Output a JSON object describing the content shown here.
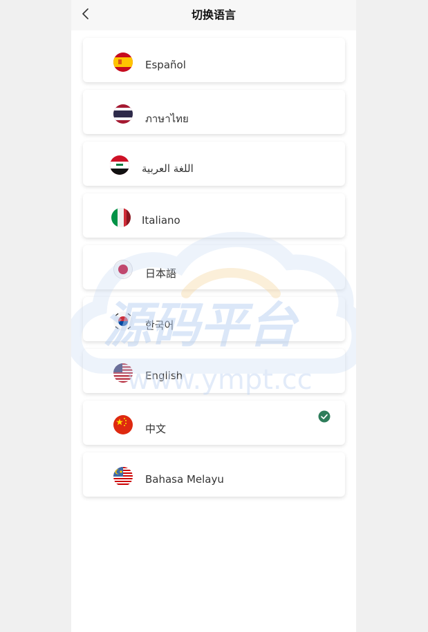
{
  "header": {
    "title": "切换语言"
  },
  "languages": [
    {
      "label": "Español",
      "flag": "spain-flag-icon"
    },
    {
      "label": "ภาษาไทย",
      "flag": "thailand-flag-icon"
    },
    {
      "label": "اللغة العربية",
      "flag": "iraq-flag-icon"
    },
    {
      "label": "Italiano",
      "flag": "italy-flag-icon"
    },
    {
      "label": "日本語",
      "flag": "japan-flag-icon"
    },
    {
      "label": "한국어",
      "flag": "korea-flag-icon"
    },
    {
      "label": "English",
      "flag": "usa-flag-icon"
    },
    {
      "label": "中文",
      "flag": "china-flag-icon",
      "selected": true
    },
    {
      "label": "Bahasa Melayu",
      "flag": "malaysia-flag-icon"
    }
  ],
  "watermark": {
    "brand": "源码平台",
    "url": "www.ympt.cc"
  },
  "colors": {
    "check": "#2e7d5b",
    "header_bg": "#f7f7f7",
    "page_bg": "#f0f0f0"
  }
}
